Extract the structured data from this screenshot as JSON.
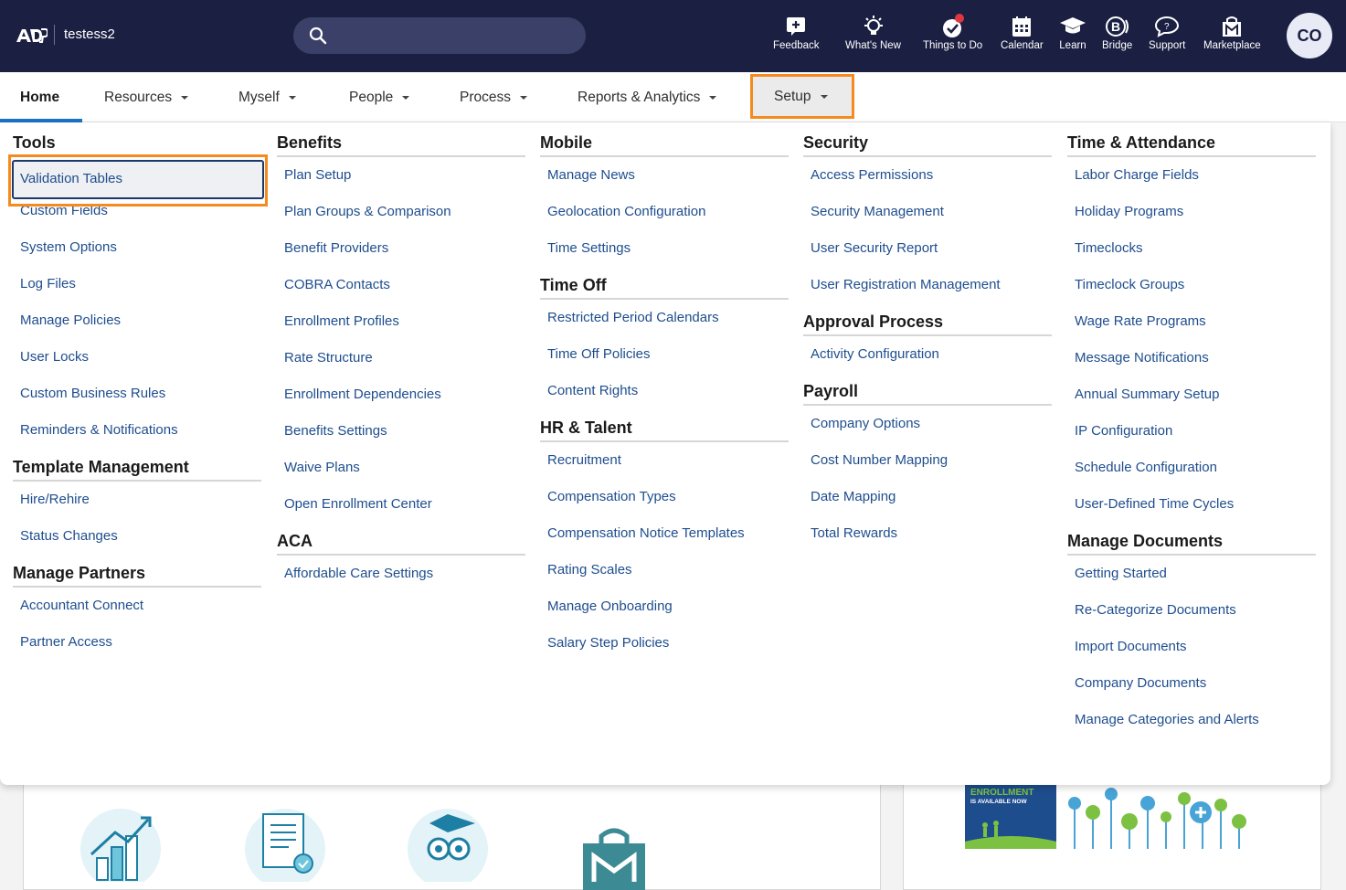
{
  "header": {
    "company": "testess2",
    "avatar_initials": "CO",
    "top_items": [
      {
        "label": "Feedback",
        "icon": "feedback-icon"
      },
      {
        "label": "What's New",
        "icon": "lightbulb-icon"
      },
      {
        "label": "Things to Do",
        "icon": "checklist-icon"
      },
      {
        "label": "Calendar",
        "icon": "calendar-icon"
      },
      {
        "label": "Learn",
        "icon": "graduation-cap-icon"
      },
      {
        "label": "Bridge",
        "icon": "bridge-icon"
      },
      {
        "label": "Support",
        "icon": "chat-bubble-icon"
      },
      {
        "label": "Marketplace",
        "icon": "shopping-bag-icon"
      }
    ]
  },
  "mainnav": {
    "home": "Home",
    "resources": "Resources",
    "myself": "Myself",
    "people": "People",
    "process": "Process",
    "reports": "Reports & Analytics",
    "setup": "Setup"
  },
  "menu": {
    "col1": [
      {
        "title": "Tools",
        "links": [
          "Validation Tables",
          "Custom Fields",
          "System Options",
          "Log Files",
          "Manage Policies",
          "User Locks",
          "Custom Business Rules",
          "Reminders & Notifications"
        ]
      },
      {
        "title": "Template Management",
        "links": [
          "Hire/Rehire",
          "Status Changes"
        ]
      },
      {
        "title": "Manage Partners",
        "links": [
          "Accountant Connect",
          "Partner Access"
        ]
      }
    ],
    "col2": [
      {
        "title": "Benefits",
        "links": [
          "Plan Setup",
          "Plan Groups & Comparison",
          "Benefit Providers",
          "COBRA Contacts",
          "Enrollment Profiles",
          "Rate Structure",
          "Enrollment Dependencies",
          "Benefits Settings",
          "Waive Plans",
          "Open Enrollment Center"
        ]
      },
      {
        "title": "ACA",
        "links": [
          "Affordable Care Settings"
        ]
      }
    ],
    "col3": [
      {
        "title": "Mobile",
        "links": [
          "Manage News",
          "Geolocation Configuration",
          "Time Settings"
        ]
      },
      {
        "title": "Time Off",
        "links": [
          "Restricted Period Calendars",
          "Time Off Policies",
          "Content Rights"
        ]
      },
      {
        "title": "HR & Talent",
        "links": [
          "Recruitment",
          "Compensation Types",
          "Compensation Notice Templates",
          "Rating Scales",
          "Manage Onboarding",
          "Salary Step Policies"
        ]
      }
    ],
    "col4": [
      {
        "title": "Security",
        "links": [
          "Access Permissions",
          "Security Management",
          "User Security Report",
          "User Registration Management"
        ]
      },
      {
        "title": "Approval Process",
        "links": [
          "Activity Configuration"
        ]
      },
      {
        "title": "Payroll",
        "links": [
          "Company Options",
          "Cost Number Mapping",
          "Date Mapping",
          "Total Rewards"
        ]
      }
    ],
    "col5": [
      {
        "title": "Time & Attendance",
        "links": [
          "Labor Charge Fields",
          "Holiday Programs",
          "Timeclocks",
          "Timeclock Groups",
          "Wage Rate Programs",
          "Message Notifications",
          "Annual Summary Setup",
          "IP Configuration",
          "Schedule Configuration",
          "User-Defined Time Cycles"
        ]
      },
      {
        "title": "Manage Documents",
        "links": [
          "Getting Started",
          "Re-Categorize Documents",
          "Import Documents",
          "Company Documents",
          "Manage Categories and Alerts"
        ]
      }
    ]
  },
  "banner": {
    "line1": "ENROLLMENT",
    "line2": "IS AVAILABLE NOW"
  },
  "colors": {
    "header_bg": "#1b2043",
    "link": "#1e4d8e",
    "highlight": "#f58b1f",
    "accent": "#1a73c8"
  }
}
